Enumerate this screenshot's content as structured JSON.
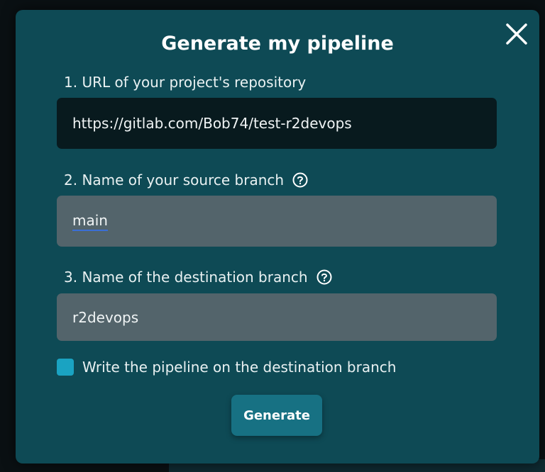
{
  "modal": {
    "title": "Generate my pipeline",
    "close_icon": "close-icon"
  },
  "fields": [
    {
      "label": "1. URL of your project's repository",
      "value": "https://gitlab.com/Bob74/test-r2devops",
      "has_help": false
    },
    {
      "label": "2. Name of your source branch",
      "value": "main",
      "has_help": true
    },
    {
      "label": "3. Name of the destination branch",
      "value": "r2devops",
      "has_help": true
    }
  ],
  "checkbox": {
    "label": "Write the pipeline on the destination branch",
    "checked": true
  },
  "actions": {
    "generate_label": "Generate"
  },
  "colors": {
    "modal_bg": "#0e4a55",
    "url_field_bg": "#081a1e",
    "branch_field_bg": "#53646b",
    "checkbox_accent": "#1aa3c2",
    "button_bg": "#177183",
    "spellcheck_underline": "#3b6fd6"
  }
}
